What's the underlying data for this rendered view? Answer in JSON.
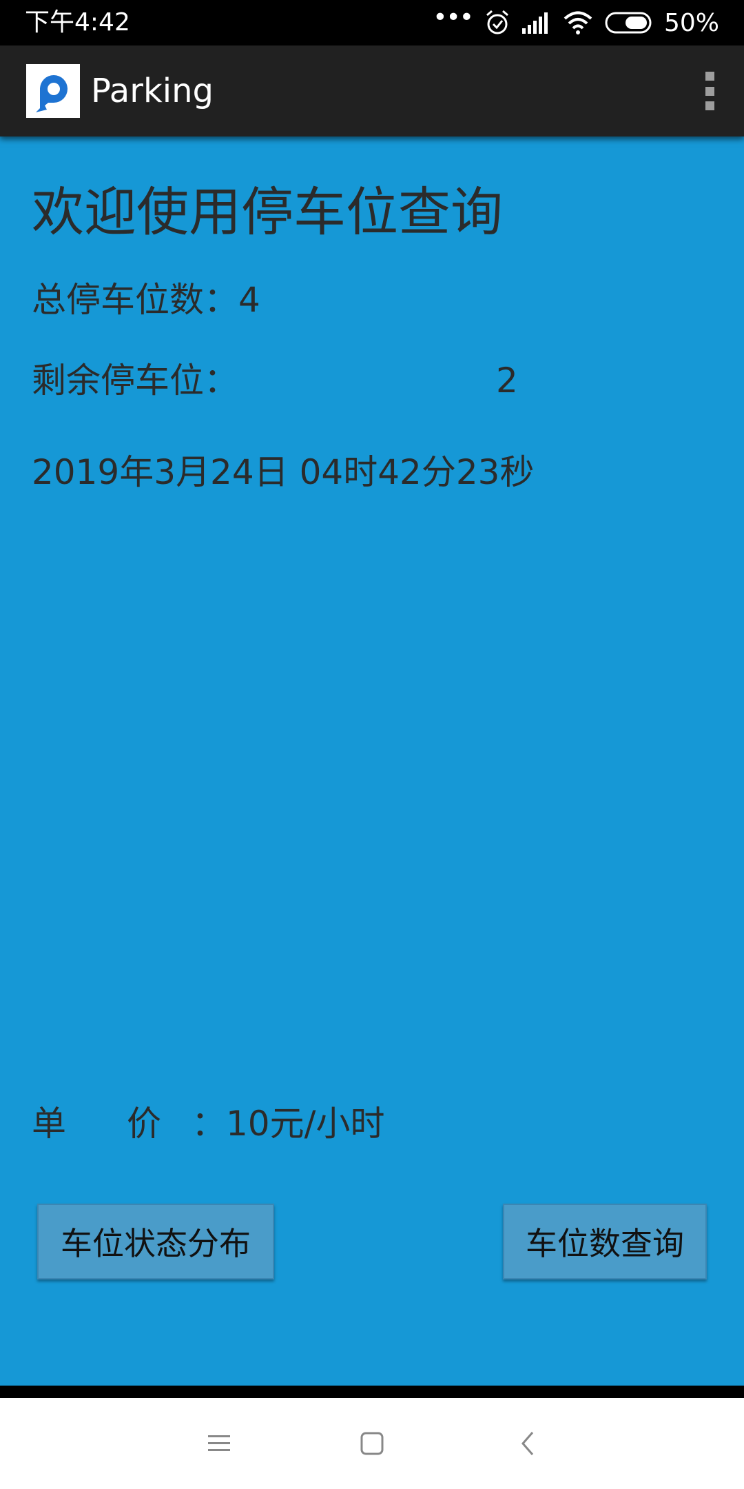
{
  "status_bar": {
    "time": "下午4:42",
    "dots": "•••",
    "battery_percent": "50%",
    "icons": [
      "alarm-icon",
      "signal-icon",
      "wifi-icon",
      "battery-icon"
    ]
  },
  "app_bar": {
    "title": "Parking",
    "logo_icon": "parking-logo-icon",
    "menu_icon": "overflow-menu-icon"
  },
  "main": {
    "heading": "欢迎使用停车位查询",
    "total_spots": "总停车位数：4",
    "remaining_label": "剩余停车位：",
    "remaining_value": "2",
    "datetime": "2019年3月24日 04时42分23秒",
    "price_label_a": "单",
    "price_label_b": "价",
    "price_value": "：10元/小时"
  },
  "buttons": {
    "status_distribution": "车位状态分布",
    "spot_count_query": "车位数查询"
  },
  "nav_bar": {
    "icons": [
      "menu-icon",
      "home-icon",
      "back-icon"
    ]
  },
  "colors": {
    "content_background": "#1698d6",
    "app_bar": "#212121",
    "button": "#4a9cc9",
    "logo_blue": "#1e73d2"
  }
}
